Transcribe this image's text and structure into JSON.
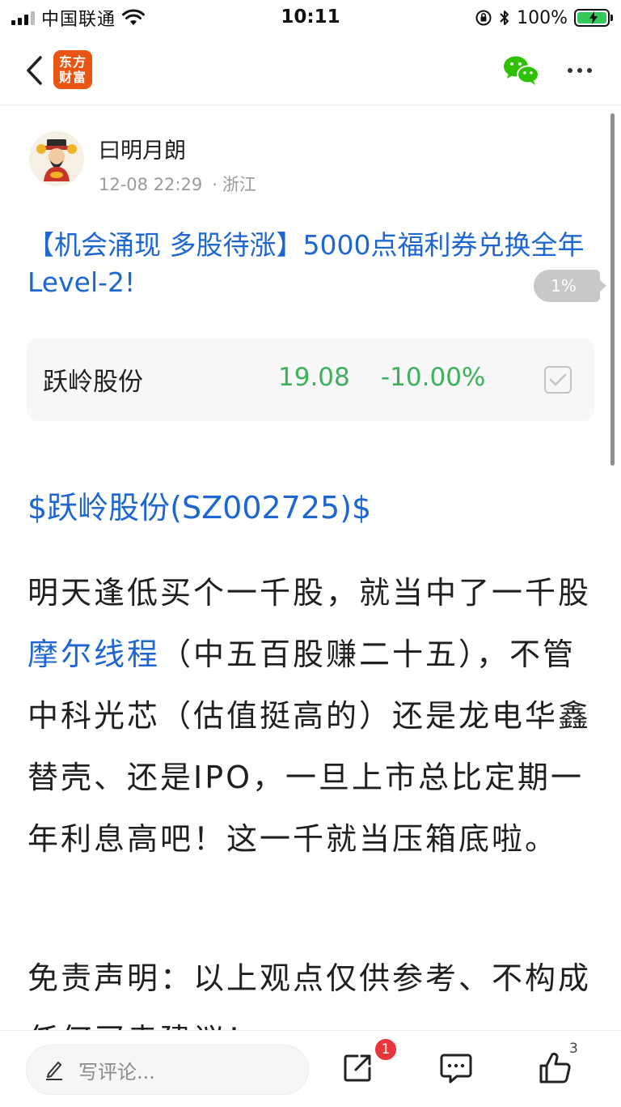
{
  "status_bar": {
    "carrier": "中国联通",
    "time": "10:11",
    "battery": "100%"
  },
  "nav": {
    "logo_line1": "东方",
    "logo_line2": "财富",
    "back_icon": "chevron-left-icon",
    "share_icon": "wechat-icon",
    "more_icon": "more-dots-icon"
  },
  "post": {
    "author": "曰明月朗",
    "timestamp": "12-08 22:29",
    "location_sep": "·",
    "location": "浙江",
    "promo_title": "【机会涌现 多股待涨】5000点福利券兑换全年Level-2!",
    "progress": "1%",
    "stock_card": {
      "name": "跃岭股份",
      "price": "19.08",
      "change": "-10.00%"
    },
    "stock_link": "$跃岭股份(SZ002725)$",
    "body_before": "明天逢低买个一千股，就当中了一千股",
    "body_mention": "摩尔线程",
    "body_after": "（中五百股赚二十五），不管中科光芯（估值挺高的）还是龙电华鑫替壳、还是IPO，一旦上市总比定期一年利息高吧！这一千就当压箱底啦。",
    "disclaimer": "免责声明：以上观点仅供参考、不构成任何买卖建议！"
  },
  "bottom_bar": {
    "comment_placeholder": "写评论...",
    "share_badge": "1",
    "like_count": "3"
  },
  "colors": {
    "link": "#1e66d0",
    "down_green": "#3eaf5b",
    "brand_orange": "#ea5513",
    "badge_red": "#e8363c"
  }
}
